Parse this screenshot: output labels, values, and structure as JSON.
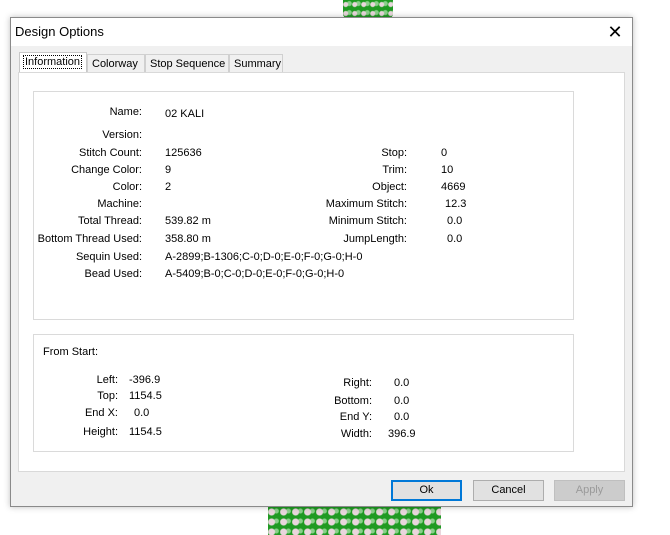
{
  "window": {
    "title": "Design Options",
    "close_symbol": "✕"
  },
  "tabs": [
    {
      "label": "Information"
    },
    {
      "label": "Colorway"
    },
    {
      "label": "Stop Sequence"
    },
    {
      "label": "Summary"
    }
  ],
  "info": {
    "name": {
      "label": "Name:",
      "value": "02 KALI"
    },
    "version": {
      "label": "Version:",
      "value": ""
    },
    "stitch_count": {
      "label": "Stitch Count:",
      "value": "125636"
    },
    "change_color": {
      "label": "Change Color:",
      "value": "9"
    },
    "color": {
      "label": "Color:",
      "value": "2"
    },
    "machine": {
      "label": "Machine:",
      "value": ""
    },
    "total_thread": {
      "label": "Total Thread:",
      "value": "539.82 m"
    },
    "bottom_thread": {
      "label": "Bottom Thread Used:",
      "value": "358.80 m"
    },
    "sequin": {
      "label": "Sequin Used:",
      "value": "A-2899;B-1306;C-0;D-0;E-0;F-0;G-0;H-0"
    },
    "bead": {
      "label": "Bead Used:",
      "value": "A-5409;B-0;C-0;D-0;E-0;F-0;G-0;H-0"
    },
    "stop": {
      "label": "Stop:",
      "value": "0"
    },
    "trim": {
      "label": "Trim:",
      "value": "10"
    },
    "object": {
      "label": "Object:",
      "value": "4669"
    },
    "max_stitch": {
      "label": "Maximum Stitch:",
      "value": "12.3"
    },
    "min_stitch": {
      "label": "Minimum Stitch:",
      "value": "0.0"
    },
    "jump_length": {
      "label": "JumpLength:",
      "value": "0.0"
    }
  },
  "from_start": {
    "heading": "From Start:",
    "left": {
      "label": "Left:",
      "value": "-396.9"
    },
    "top": {
      "label": "Top:",
      "value": "1154.5"
    },
    "end_x": {
      "label": "End X:",
      "value": "0.0"
    },
    "height": {
      "label": "Height:",
      "value": "1154.5"
    },
    "right": {
      "label": "Right:",
      "value": "0.0"
    },
    "bottom": {
      "label": "Bottom:",
      "value": "0.0"
    },
    "end_y": {
      "label": "End Y:",
      "value": "0.0"
    },
    "width": {
      "label": "Width:",
      "value": "396.9"
    }
  },
  "buttons": {
    "ok": "Ok",
    "cancel": "Cancel",
    "apply": "Apply"
  }
}
